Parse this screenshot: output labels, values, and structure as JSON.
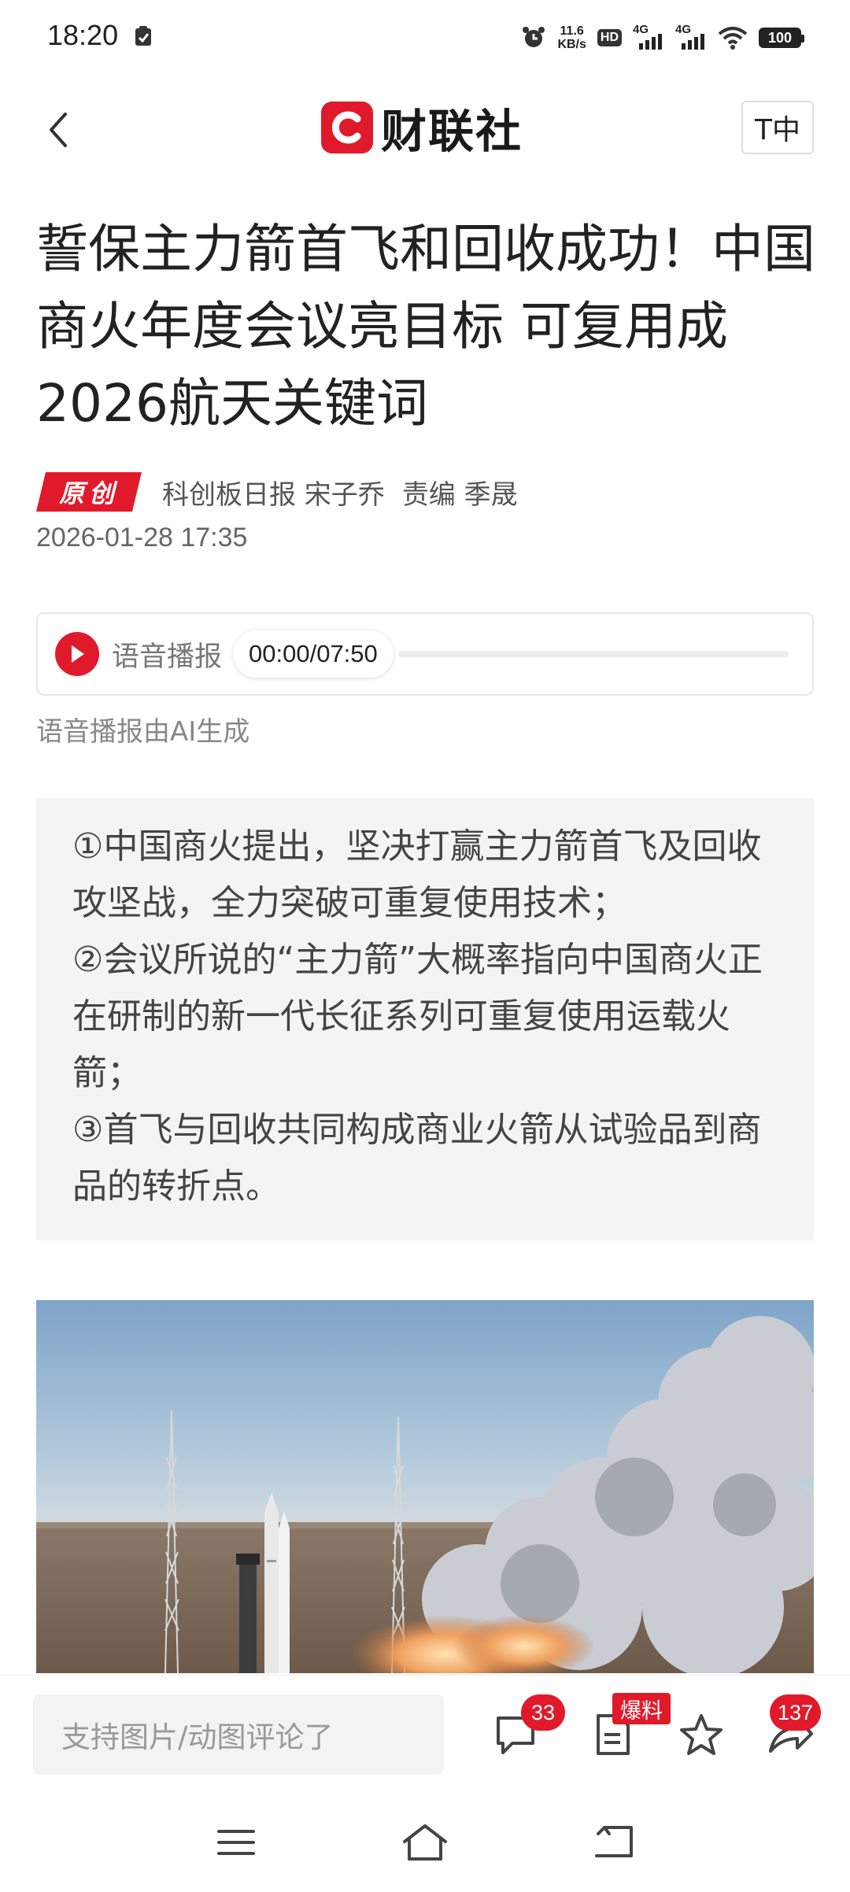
{
  "status_bar": {
    "time": "18:20",
    "net_speed_value": "11.6",
    "net_speed_unit": "KB/s",
    "hd_label": "HD",
    "signal1_label": "4G",
    "signal2_label": "4G",
    "battery": "100"
  },
  "header": {
    "logo_text": "财联社",
    "font_toggle_label": "T中"
  },
  "article": {
    "title": "誓保主力箭首飞和回收成功！中国商火年度会议亮目标 可复用成2026航天关键词",
    "badge": "原创",
    "source": "科创板日报 宋子乔",
    "editor": "责编 季晟",
    "date": "2026-01-28 17:35"
  },
  "audio": {
    "label": "语音播报",
    "time_display": "00:00/07:50",
    "progress": 0,
    "note": "语音播报由AI生成"
  },
  "summary": {
    "points": [
      "①中国商火提出，坚决打赢主力箭首飞及回收攻坚战，全力突破可重复使用技术；",
      "②会议所说的“主力箭”大概率指向中国商火正在研制的新一代长征系列可重复使用运载火箭；",
      "③首飞与回收共同构成商业火箭从试验品到商品的转折点。"
    ]
  },
  "bottom_bar": {
    "comment_placeholder": "支持图片/动图评论了",
    "comment_count": "33",
    "report_badge": "爆料",
    "share_count": "137"
  },
  "colors": {
    "brand_red": "#e11a2b",
    "summary_bg": "#f4f4f4"
  },
  "icons": [
    "back-icon",
    "play-icon",
    "comment-icon",
    "report-icon",
    "star-icon",
    "share-icon",
    "menu-icon",
    "home-icon",
    "return-icon"
  ]
}
